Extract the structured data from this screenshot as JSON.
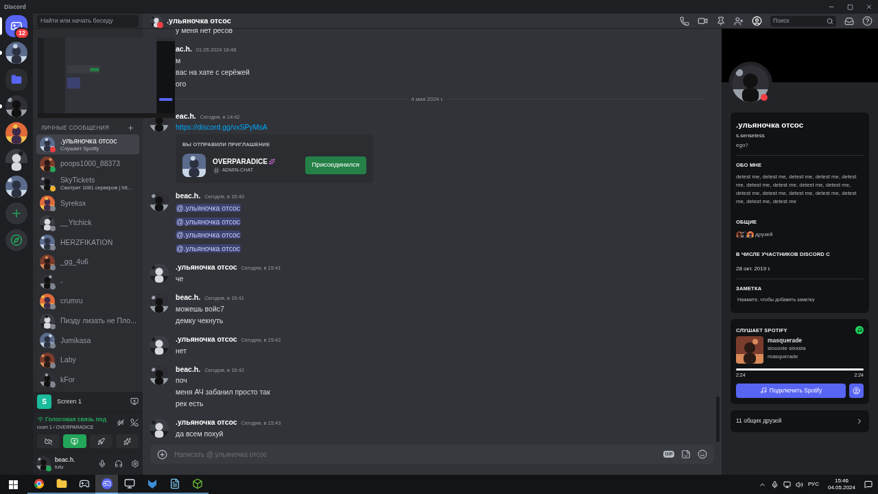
{
  "app_title": "Discord",
  "rail": {
    "items": [
      {
        "kind": "home",
        "selected": true,
        "unread": false,
        "badge": "12"
      },
      {
        "kind": "avatar",
        "selected": false,
        "unread": true
      },
      {
        "kind": "folder",
        "selected": false,
        "unread": false
      },
      {
        "kind": "avatar",
        "selected": false,
        "unread": true
      },
      {
        "kind": "avatar",
        "selected": false,
        "unread": false
      },
      {
        "kind": "avatar",
        "selected": false,
        "unread": false
      },
      {
        "kind": "avatar",
        "selected": false,
        "unread": false
      },
      {
        "kind": "add",
        "selected": false,
        "unread": false
      },
      {
        "kind": "explore",
        "selected": false,
        "unread": false
      }
    ]
  },
  "sidebar": {
    "search_placeholder": "Найти или начать беседу",
    "dm_heading": "ЛИЧНЫЕ СООБЩЕНИЯ",
    "dms": [
      {
        "name": ".ульяночка отсос",
        "subtitle": "Слушает Spotify",
        "color": "#f23f43",
        "selected": true
      },
      {
        "name": "poops1000_88373",
        "color": "#23a55a",
        "selected": false
      },
      {
        "name": "SkyTickets",
        "subtitle": "Смотрит 1081 серверов | htt...",
        "color": "#f0b232",
        "selected": false
      },
      {
        "name": "Syreksx",
        "color": "#80848e",
        "selected": false
      },
      {
        "name": "__Ytchick",
        "color": "#80848e",
        "selected": false
      },
      {
        "name": "HERZFIKATION",
        "color": "#80848e",
        "selected": false
      },
      {
        "name": "_gg_4u6",
        "color": "#80848e",
        "selected": false
      },
      {
        "name": "-",
        "color": "#80848e",
        "selected": false
      },
      {
        "name": "crumru",
        "color": "#80848e",
        "selected": false
      },
      {
        "name": "Пизду лизать не Пло...",
        "color": "#80848e",
        "selected": false
      },
      {
        "name": "Jumikasa",
        "color": "#80848e",
        "selected": false
      },
      {
        "name": "Laby",
        "color": "#80848e",
        "selected": false
      },
      {
        "name": "kFor",
        "color": "#80848e",
        "selected": false
      }
    ]
  },
  "screen_share": {
    "initial": "S",
    "label": "Screen 1"
  },
  "voice": {
    "status": "Голосовая связь под",
    "channel": "room 1 / OVERPARADICE",
    "controls": [
      {
        "kind": "camera",
        "on": false
      },
      {
        "kind": "screen",
        "on": true
      },
      {
        "kind": "activity",
        "on": false
      },
      {
        "kind": "soundboard",
        "on": false
      }
    ]
  },
  "user": {
    "name": "beac.h.",
    "status_text": "tutu",
    "color": "#23a55a"
  },
  "chat": {
    "title": ".ульяночка отсос",
    "title_dot": {
      "color": "#f23f43"
    },
    "search_placeholder": "Поиск",
    "input_placeholder": "Написать @.ульяночка отсос",
    "gif_label": "GIF",
    "messages": [
      {
        "kind": "continuation",
        "lines": [
          {
            "kind": "text",
            "text": "у меня нет ресов"
          }
        ]
      },
      {
        "kind": "group",
        "author": "ac.h.",
        "time": "01.05.2024 16:48",
        "lines": [
          {
            "kind": "text",
            "text": "м"
          },
          {
            "kind": "text",
            "text": "вас на хате с серёжей"
          },
          {
            "kind": "text",
            "text": "ого"
          }
        ]
      },
      {
        "kind": "divider",
        "text": "4 мая 2024 г."
      },
      {
        "kind": "group",
        "author": "eac.h.",
        "time": "Сегодня, в 14:42",
        "avatar": true,
        "lines": [
          {
            "kind": "link",
            "text": "https://discord.gg/vxSPyMsA"
          },
          {
            "kind": "invite",
            "heading": "ВЫ ОТПРАВИЛИ ПРИГЛАШЕНИЕ",
            "server": "OVERPARADICE",
            "channel": "ADMIN-CHAT",
            "button": "Присоединился"
          }
        ]
      },
      {
        "kind": "group",
        "author": "beac.h.",
        "time": "Сегодня, в 15:40",
        "avatar": true,
        "lines": [
          {
            "kind": "mention",
            "text": "@.ульяночка отсос"
          },
          {
            "kind": "mention",
            "text": "@.ульяночка отсос"
          },
          {
            "kind": "mention",
            "text": "@.ульяночка отсос"
          },
          {
            "kind": "mention",
            "text": "@.ульяночка отсос"
          }
        ]
      },
      {
        "kind": "group",
        "author": ".ульяночка отсос",
        "time": "Сегодня, в 15:41",
        "avatar": true,
        "lines": [
          {
            "kind": "text",
            "text": "че"
          }
        ]
      },
      {
        "kind": "group",
        "author": "beac.h.",
        "time": "Сегодня, в 15:41",
        "avatar": true,
        "lines": [
          {
            "kind": "text",
            "text": "можешь войс7"
          },
          {
            "kind": "text",
            "text": "демку чекнуть"
          }
        ]
      },
      {
        "kind": "group",
        "author": ".ульяночка отсос",
        "time": "Сегодня, в 15:42",
        "avatar": true,
        "lines": [
          {
            "kind": "text",
            "text": "нет"
          }
        ]
      },
      {
        "kind": "group",
        "author": "beac.h.",
        "time": "Сегодня, в 15:42",
        "avatar": true,
        "lines": [
          {
            "kind": "text",
            "text": "поч"
          },
          {
            "kind": "text",
            "text": "меня АЧ забанил просто так"
          },
          {
            "kind": "text",
            "text": "рек есть"
          }
        ]
      },
      {
        "kind": "group",
        "author": ".ульяночка отсос",
        "time": "Сегодня, в 15:43",
        "avatar": true,
        "lines": [
          {
            "kind": "text",
            "text": "да всем похуй"
          }
        ]
      }
    ]
  },
  "profile": {
    "color": "#f23f43",
    "display_name": ".ульяночка отсос",
    "username": "s.senseless",
    "pronouns": "ego?",
    "about": {
      "heading": "ОБО МНЕ",
      "text": "detest me, detest me, detest me, detest me, detest me, detest me, detest me, detest me, detest me, detest me, detest me, detest me, detest me, detest me, detest me, detest me"
    },
    "mutual": {
      "heading": "ОБЩИЕ",
      "text": "друзей"
    },
    "member_since": {
      "heading": "В ЧИСЛЕ УЧАСТНИКОВ DISCORD С",
      "text": "28 окт. 2019 г."
    },
    "note": {
      "heading": "ЗАМЕТКА",
      "placeholder": "Нажмите, чтобы добавить заметку"
    },
    "spotify": {
      "heading": "СЛУШАЕТ SPOTIFY",
      "track": "masquerade",
      "artist": "siouxxie sixxsta",
      "album": "masquerade",
      "level": 1,
      "elapsed": "2:24",
      "duration": "2:24",
      "button": "Подключить Spotify"
    },
    "friends": "11 общих друзей"
  },
  "taskbar": {
    "apps": [
      {
        "kind": "browser",
        "selected": false
      },
      {
        "kind": "files",
        "selected": false
      },
      {
        "kind": "steam",
        "selected": false
      },
      {
        "kind": "chat",
        "selected": true
      },
      {
        "kind": "monitor",
        "selected": false
      },
      {
        "kind": "fox",
        "selected": false
      },
      {
        "kind": "notes",
        "selected": false
      },
      {
        "kind": "cube",
        "selected": false
      }
    ],
    "language": "РУС",
    "time": "15:46",
    "date": "04.05.2024"
  }
}
